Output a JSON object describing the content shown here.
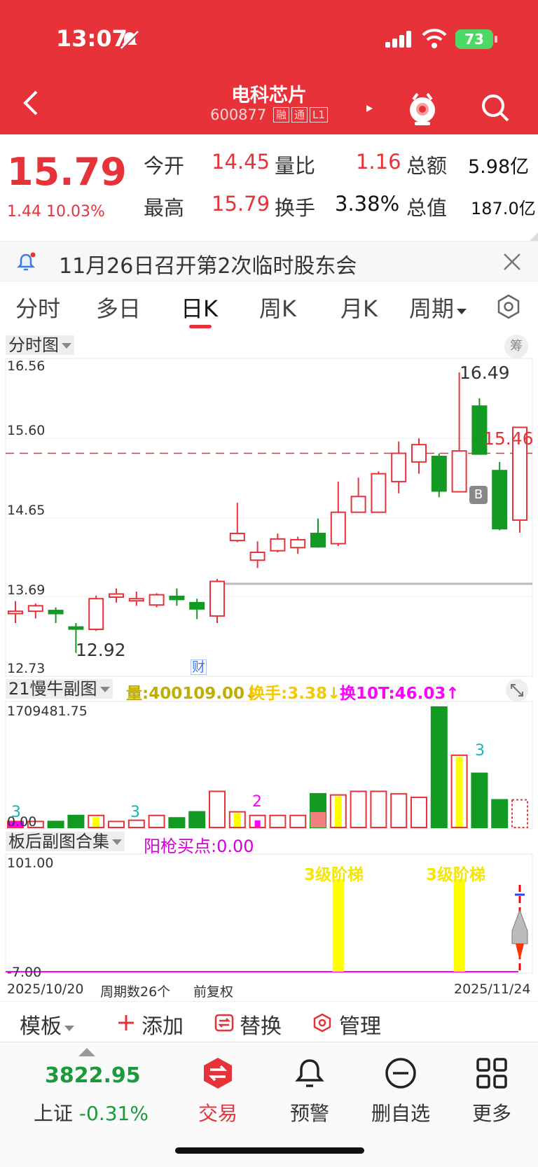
{
  "status": {
    "time": "13:07",
    "battery": "73"
  },
  "header": {
    "title": "电科芯片",
    "code": "600877",
    "tags": [
      "融",
      "通",
      "L1"
    ]
  },
  "quote": {
    "price": "15.79",
    "change": "1.44",
    "change_pct": "10.03%",
    "fields": [
      {
        "label": "今开",
        "value": "14.45"
      },
      {
        "label": "量比",
        "value": "1.16"
      },
      {
        "label": "总额",
        "value": "5.98亿"
      },
      {
        "label": "最高",
        "value": "15.79"
      },
      {
        "label": "换手",
        "value": "3.38%"
      },
      {
        "label": "总值",
        "value": "187.0亿"
      }
    ]
  },
  "notice": {
    "text": "11月26日召开第2次临时股东会"
  },
  "tabs": [
    "分时",
    "多日",
    "日K",
    "周K",
    "月K",
    "周期"
  ],
  "main_chart": {
    "label": "分时图",
    "chip_label": "筹",
    "y_ticks": [
      "16.56",
      "15.60",
      "14.65",
      "13.69",
      "12.73"
    ],
    "high_label": "16.49",
    "low_label": "12.92",
    "last_label": "15.46",
    "b_marker": "B",
    "finance_marker": "财"
  },
  "vol_chart": {
    "label": "21慢牛副图",
    "indicators": [
      "量:400109.00↓",
      "换手:3.38↓",
      "换10T:46.03↑"
    ],
    "max_label": "1709481.75",
    "zero_label": "0.00",
    "annotations": [
      "3",
      "3",
      "2",
      "3"
    ]
  },
  "ind_chart": {
    "label": "板后副图合集",
    "indicator": "阳枪买点:0.00",
    "max_label": "101.00",
    "min_label": "-7.00",
    "ladder_labels": [
      "3级阶梯",
      "3级阶梯"
    ]
  },
  "date_axis": {
    "start": "2025/10/20",
    "periods": "周期数26个",
    "adjust": "前复权",
    "end": "2025/11/24"
  },
  "chart_data": {
    "type": "candlestick",
    "x_range": [
      "2025/10/20",
      "2025/11/24"
    ],
    "ylim": [
      12.73,
      16.56
    ],
    "candles": [
      {
        "o": 13.42,
        "c": 13.45,
        "h": 13.58,
        "l": 13.3
      },
      {
        "o": 13.45,
        "c": 13.52,
        "h": 13.55,
        "l": 13.36
      },
      {
        "o": 13.46,
        "c": 13.42,
        "h": 13.5,
        "l": 13.3
      },
      {
        "o": 13.25,
        "c": 13.24,
        "h": 13.3,
        "l": 12.92
      },
      {
        "o": 13.22,
        "c": 13.61,
        "h": 13.65,
        "l": 13.2
      },
      {
        "o": 13.63,
        "c": 13.67,
        "h": 13.74,
        "l": 13.56
      },
      {
        "o": 13.61,
        "c": 13.61,
        "h": 13.7,
        "l": 13.52
      },
      {
        "o": 13.53,
        "c": 13.66,
        "h": 13.68,
        "l": 13.5
      },
      {
        "o": 13.64,
        "c": 13.6,
        "h": 13.74,
        "l": 13.52
      },
      {
        "o": 13.56,
        "c": 13.48,
        "h": 13.61,
        "l": 13.35
      },
      {
        "o": 13.39,
        "c": 13.83,
        "h": 13.86,
        "l": 13.3
      },
      {
        "o": 14.35,
        "c": 14.44,
        "h": 14.83,
        "l": 14.33
      },
      {
        "o": 14.1,
        "c": 14.2,
        "h": 14.34,
        "l": 14.0
      },
      {
        "o": 14.22,
        "c": 14.37,
        "h": 14.44,
        "l": 14.2
      },
      {
        "o": 14.26,
        "c": 14.36,
        "h": 14.4,
        "l": 14.18
      },
      {
        "o": 14.44,
        "c": 14.27,
        "h": 14.63,
        "l": 14.26
      },
      {
        "o": 14.31,
        "c": 14.71,
        "h": 15.1,
        "l": 14.28
      },
      {
        "o": 14.71,
        "c": 14.91,
        "h": 15.15,
        "l": 14.71
      },
      {
        "o": 14.71,
        "c": 15.2,
        "h": 15.23,
        "l": 14.71
      },
      {
        "o": 15.1,
        "c": 15.46,
        "h": 15.61,
        "l": 14.95
      },
      {
        "o": 15.35,
        "c": 15.57,
        "h": 15.65,
        "l": 15.2
      },
      {
        "o": 15.42,
        "c": 14.98,
        "h": 15.46,
        "l": 14.9
      },
      {
        "o": 14.97,
        "c": 15.49,
        "h": 16.49,
        "l": 14.97
      },
      {
        "o": 16.06,
        "c": 15.45,
        "h": 16.16,
        "l": 15.45
      },
      {
        "o": 15.24,
        "c": 14.5,
        "h": 15.35,
        "l": 14.48
      },
      {
        "o": 14.61,
        "c": 15.79,
        "h": 15.79,
        "l": 14.45
      }
    ],
    "volume_max": 1709481.75,
    "volume_last": 400109.0,
    "ref_line": 15.46,
    "indicator_range": [
      -7.0,
      101.0
    ]
  },
  "toolbar": {
    "template": "模板",
    "add": "添加",
    "replace": "替换",
    "manage": "管理"
  },
  "bottom_nav": {
    "index_value": "3822.95",
    "index_name": "上证",
    "index_pct": "-0.31%",
    "items": [
      "交易",
      "预警",
      "删自选",
      "更多"
    ]
  },
  "colors": {
    "up": "#e8323a",
    "down": "#129a23",
    "accent": "#e8323a",
    "yellow": "#ffff00",
    "magenta": "#ff00ff"
  }
}
